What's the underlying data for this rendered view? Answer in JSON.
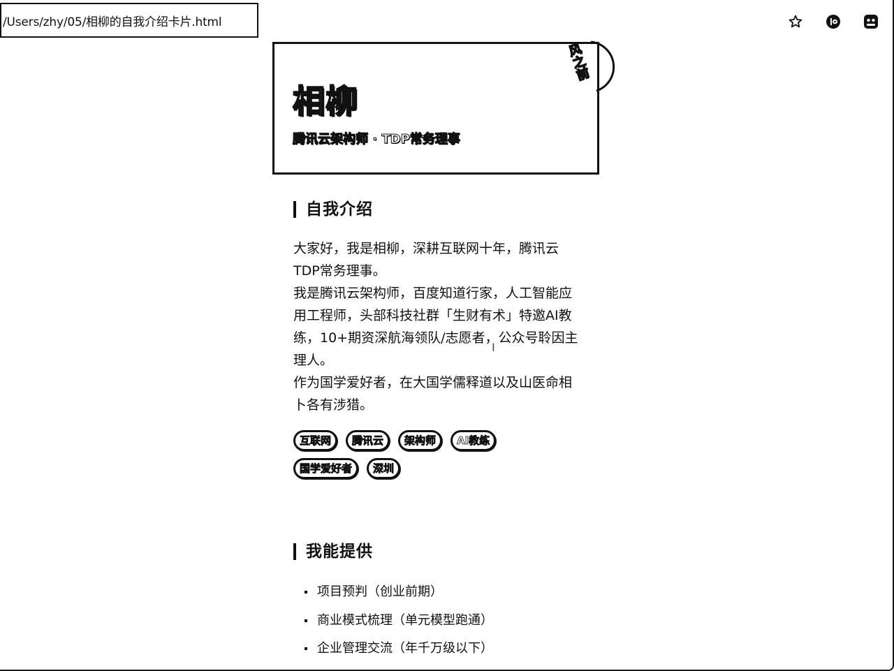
{
  "browser": {
    "address": "/Users/zhy/05/相柳的自我介绍卡片.html",
    "icons": [
      "star-icon",
      "extension-icon",
      "profile-icon"
    ]
  },
  "card": {
    "name": "相柳",
    "subtitle": "腾讯云架构师 · TDP常务理事",
    "ribbon": "风之前"
  },
  "intro": {
    "title": "自我介绍",
    "paragraphs": [
      "大家好，我是相柳，深耕互联网十年，腾讯云TDP常务理事。",
      "我是腾讯云架构师，百度知道行家，人工智能应用工程师，头部科技社群「生财有术」特邀AI教练，10+期资深航海领队/志愿者，公众号聆因主理人。",
      "作为国学爱好者，在大国学儒释道以及山医命相卜各有涉猎。"
    ],
    "tags": [
      "互联网",
      "腾讯云",
      "架构师",
      "AI教练",
      "国学爱好者",
      "深圳"
    ]
  },
  "offer": {
    "title": "我能提供",
    "items": [
      "项目预判（创业前期）",
      "商业模式梳理（单元模型跑通）",
      "企业管理交流（年千万级以下）"
    ]
  }
}
